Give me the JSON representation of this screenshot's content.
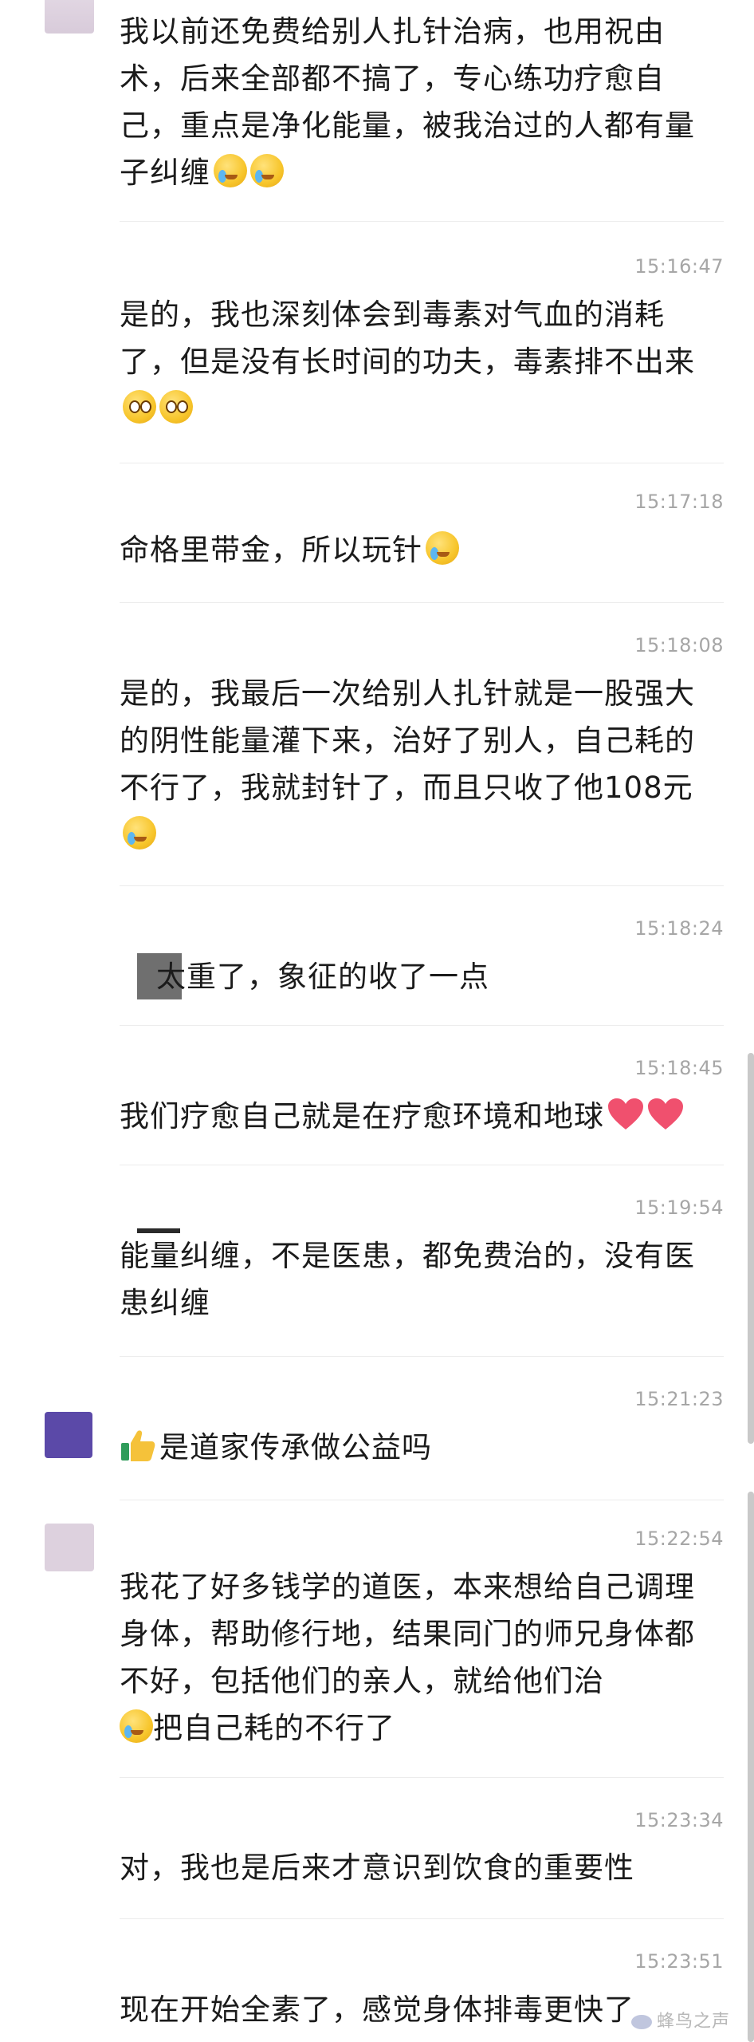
{
  "messages": [
    {
      "text": "我以前还免费给别人扎针治病，也用祝由术，后来全部都不搞了，专心练功疗愈自己，重点是净化能量，被我治过的人都有量子纠缠",
      "emoji": "loudly-crying-face",
      "time": ""
    },
    {
      "time": "15:16:47",
      "text": "是的，我也深刻体会到毒素对气血的消耗了，但是没有长时间的功夫，毒素排不出来",
      "emoji": "pleading-face"
    },
    {
      "time": "15:17:18",
      "text": "命格里带金，所以玩针",
      "emoji": "loudly-crying-face"
    },
    {
      "time": "15:18:08",
      "text": "是的，我最后一次给别人扎针就是一股强大的阴性能量灌下来，治好了别人，自己耗的不行了，我就封针了，而且只收了他108元",
      "emoji": "loudly-crying-face"
    },
    {
      "time": "15:18:24",
      "text": "太重了，象征的收了一点"
    },
    {
      "time": "15:18:45",
      "text": "我们疗愈自己就是在疗愈环境和地球",
      "emoji": "red-heart"
    },
    {
      "time": "15:19:54",
      "text": "能量纠缠，不是医患，都免费治的，没有医患纠缠"
    },
    {
      "time": "15:21:23",
      "text": "是道家传承做公益吗",
      "emoji": "thumbs-up"
    },
    {
      "time": "15:22:54",
      "text": "我花了好多钱学的道医，本来想给自己调理身体，帮助修行地，结果同门的师兄身体都不好，包括他们的亲人，就给他们治",
      "text_after_emoji": "把自己耗的不行了",
      "emoji": "loudly-crying-face"
    },
    {
      "time": "15:23:34",
      "text": "对，我也是后来才意识到饮食的重要性"
    },
    {
      "time": "15:23:51",
      "text": "现在开始全素了，感觉身体排毒更快了"
    }
  ],
  "watermark": {
    "text": "蜂鸟之声"
  },
  "colors": {
    "text": "#1b1b1b",
    "timestamp": "#a6a6a6",
    "divider": "#ececec",
    "avatar_purple": "#5b49a8",
    "avatar_pink": "#ddd1de"
  }
}
